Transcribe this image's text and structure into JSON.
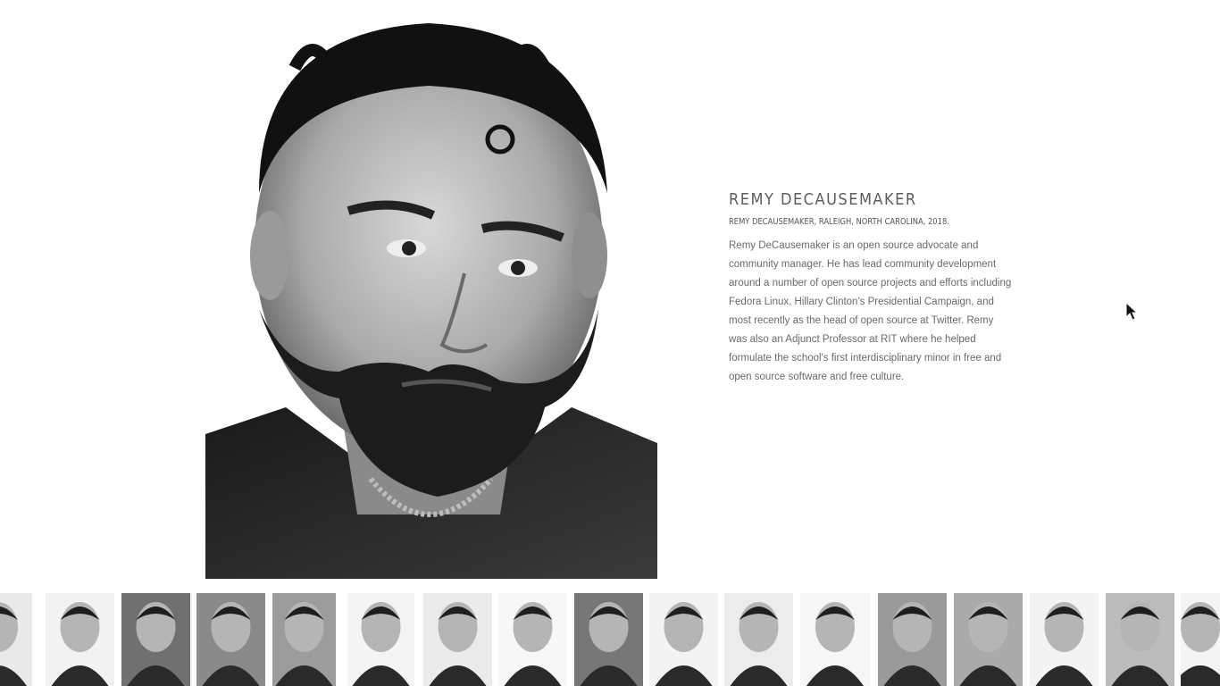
{
  "profile": {
    "name": "REMY DECAUSEMAKER",
    "caption": "REMY DECAUSEMAKER, RALEIGH, NORTH CAROLINA, 2018.",
    "bio": "Remy DeCausemaker is an open source advocate and community manager. He has lead community development around a number of open source projects and efforts including Fedora Linux, Hillary Clinton's Presidential Campaign, and most recently as the head of open source at Twitter. Remy was also an Adjunct Professor at RIT where he helped formulate the school's first interdisciplinary minor in free and open source software and free culture."
  },
  "thumbnails": [
    {
      "label": "portrait-1"
    },
    {
      "label": "portrait-2"
    },
    {
      "label": "portrait-3"
    },
    {
      "label": "portrait-4"
    },
    {
      "label": "portrait-5"
    },
    {
      "label": "portrait-6"
    },
    {
      "label": "portrait-7"
    },
    {
      "label": "portrait-8"
    },
    {
      "label": "portrait-9"
    },
    {
      "label": "portrait-10"
    },
    {
      "label": "portrait-11"
    },
    {
      "label": "portrait-12"
    },
    {
      "label": "portrait-13"
    },
    {
      "label": "portrait-14"
    },
    {
      "label": "portrait-15"
    },
    {
      "label": "portrait-16"
    },
    {
      "label": "portrait-17"
    }
  ]
}
